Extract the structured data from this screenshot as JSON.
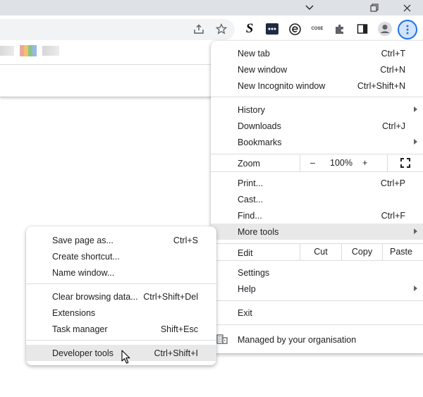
{
  "window": {
    "controls": [
      "chevron-down-icon",
      "restore-icon",
      "close-icon"
    ]
  },
  "toolbar": {
    "icons": [
      "share-icon",
      "star-icon",
      "s-extension-icon",
      "dots-extension-icon",
      "e-extension-icon",
      "cose-extension-icon",
      "puzzle-icon",
      "sidepanel-icon",
      "profile-icon",
      "menu-icon"
    ],
    "cose_ext_text": "COSE"
  },
  "main_menu": {
    "new_tab": {
      "label": "New tab",
      "shortcut": "Ctrl+T"
    },
    "new_window": {
      "label": "New window",
      "shortcut": "Ctrl+N"
    },
    "new_incognito": {
      "label": "New Incognito window",
      "shortcut": "Ctrl+Shift+N"
    },
    "history": {
      "label": "History"
    },
    "downloads": {
      "label": "Downloads",
      "shortcut": "Ctrl+J"
    },
    "bookmarks": {
      "label": "Bookmarks"
    },
    "zoom": {
      "label": "Zoom",
      "minus": "–",
      "value": "100%",
      "plus": "+"
    },
    "print": {
      "label": "Print...",
      "shortcut": "Ctrl+P"
    },
    "cast": {
      "label": "Cast..."
    },
    "find": {
      "label": "Find...",
      "shortcut": "Ctrl+F"
    },
    "more_tools": {
      "label": "More tools"
    },
    "edit": {
      "label": "Edit",
      "cut": "Cut",
      "copy": "Copy",
      "paste": "Paste"
    },
    "settings": {
      "label": "Settings"
    },
    "help": {
      "label": "Help"
    },
    "exit": {
      "label": "Exit"
    },
    "managed": {
      "label": "Managed by your organisation"
    }
  },
  "sub_menu": {
    "save_page": {
      "label": "Save page as...",
      "shortcut": "Ctrl+S"
    },
    "create_shortcut": {
      "label": "Create shortcut..."
    },
    "name_window": {
      "label": "Name window..."
    },
    "clear_data": {
      "label": "Clear browsing data...",
      "shortcut": "Ctrl+Shift+Del"
    },
    "extensions": {
      "label": "Extensions"
    },
    "task_manager": {
      "label": "Task manager",
      "shortcut": "Shift+Esc"
    },
    "dev_tools": {
      "label": "Developer tools",
      "shortcut": "Ctrl+Shift+I"
    }
  },
  "colors": {
    "accent": "#1a73e8",
    "hover": "#e8e8e8",
    "separator": "#dadce0"
  }
}
